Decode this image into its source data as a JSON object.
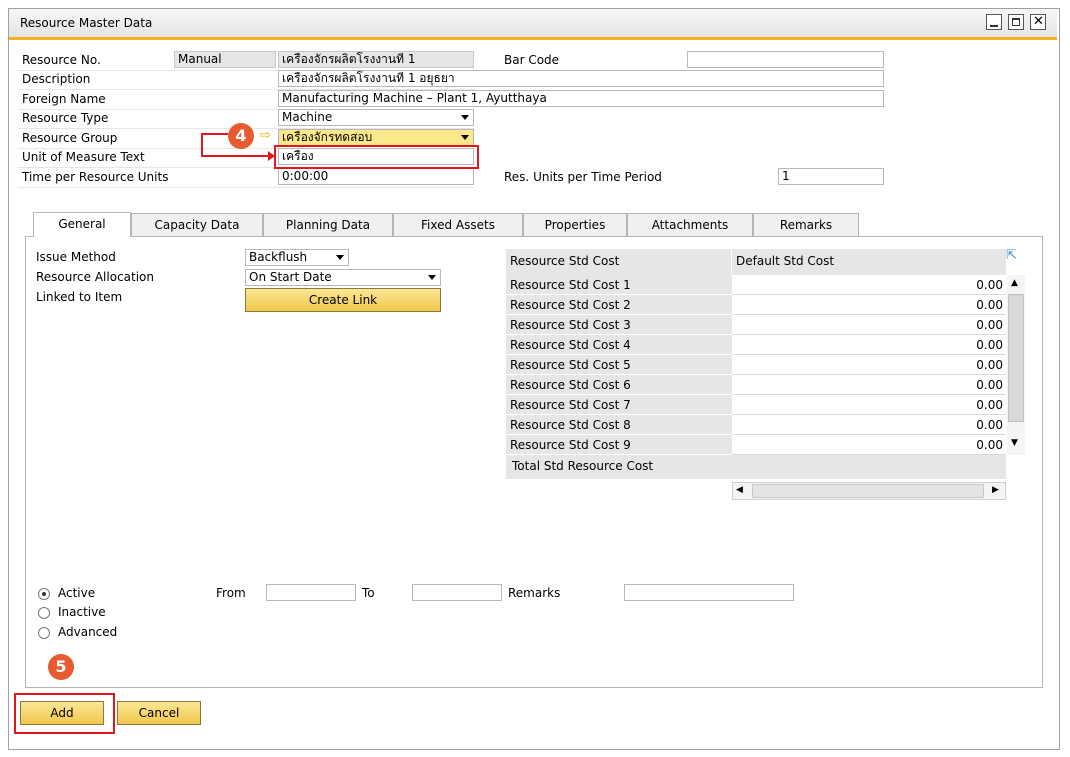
{
  "window": {
    "title": "Resource Master Data"
  },
  "header": {
    "resource_no": {
      "label": "Resource No.",
      "series": "Manual",
      "value": "เครื่องจักรผลิตโรงงานที่ 1"
    },
    "bar_code": {
      "label": "Bar Code",
      "value": ""
    },
    "description": {
      "label": "Description",
      "value": "เครื่องจักรผลิตโรงงานที่ 1 อยุธยา"
    },
    "foreign_name": {
      "label": "Foreign Name",
      "value": "Manufacturing Machine – Plant 1, Ayutthaya"
    },
    "resource_type": {
      "label": "Resource Type",
      "value": "Machine"
    },
    "resource_group": {
      "label": "Resource Group",
      "value": "เครื่องจักรทดสอบ"
    },
    "unit_of_measure": {
      "label": "Unit of Measure Text",
      "value": "เครื่อง"
    },
    "time_per_resource": {
      "label": "Time per Resource Units",
      "value": "0:00:00"
    },
    "res_units_per_time": {
      "label": "Res. Units per Time Period",
      "value": "1"
    }
  },
  "tabs": [
    {
      "label": "General",
      "active": true
    },
    {
      "label": "Capacity Data"
    },
    {
      "label": "Planning Data"
    },
    {
      "label": "Fixed Assets"
    },
    {
      "label": "Properties"
    },
    {
      "label": "Attachments"
    },
    {
      "label": "Remarks"
    }
  ],
  "general": {
    "issue_method": {
      "label": "Issue Method",
      "value": "Backflush"
    },
    "resource_allocation": {
      "label": "Resource Allocation",
      "value": "On Start Date"
    },
    "linked_to_item": {
      "label": "Linked to Item",
      "button": "Create Link"
    }
  },
  "cost_grid": {
    "col1": "Resource Std Cost",
    "col2": "Default Std Cost",
    "rows": [
      {
        "label": "Resource Std Cost 1",
        "value": "0.00"
      },
      {
        "label": "Resource Std Cost 2",
        "value": "0.00"
      },
      {
        "label": "Resource Std Cost 3",
        "value": "0.00"
      },
      {
        "label": "Resource Std Cost 4",
        "value": "0.00"
      },
      {
        "label": "Resource Std Cost 5",
        "value": "0.00"
      },
      {
        "label": "Resource Std Cost 6",
        "value": "0.00"
      },
      {
        "label": "Resource Std Cost 7",
        "value": "0.00"
      },
      {
        "label": "Resource Std Cost 8",
        "value": "0.00"
      },
      {
        "label": "Resource Std Cost 9",
        "value": "0.00"
      }
    ],
    "total_label": "Total Std Resource Cost"
  },
  "status": {
    "active": "Active",
    "inactive": "Inactive",
    "advanced": "Advanced",
    "selected": "Active",
    "from_label": "From",
    "to_label": "To",
    "remarks_label": "Remarks"
  },
  "footer": {
    "add": "Add",
    "cancel": "Cancel"
  },
  "annotations": {
    "step4": "4",
    "step5": "5"
  },
  "colors": {
    "accent": "#f2b21b",
    "highlight": "#e0181e",
    "badge": "#e85a2f"
  }
}
